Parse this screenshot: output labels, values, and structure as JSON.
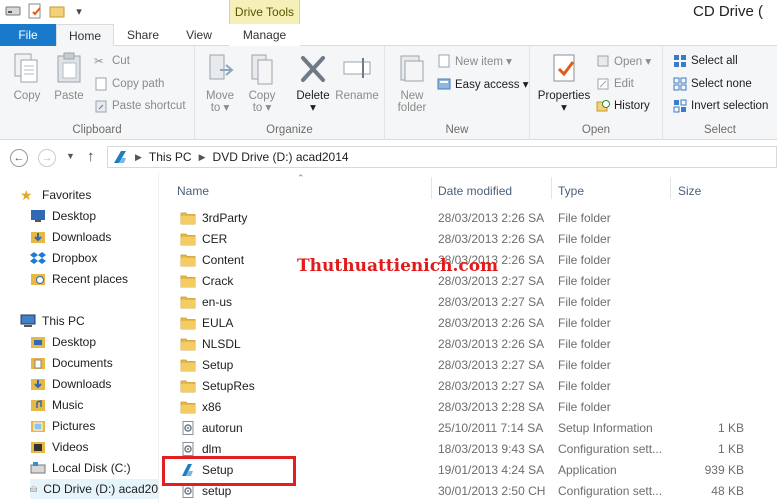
{
  "window": {
    "title": "CD Drive ("
  },
  "context_tab": {
    "label": "Drive Tools"
  },
  "tabs": {
    "file": "File",
    "home": "Home",
    "share": "Share",
    "view": "View",
    "manage": "Manage"
  },
  "ribbon": {
    "clipboard": {
      "label": "Clipboard",
      "copy": "Copy",
      "paste": "Paste",
      "cut": "Cut",
      "copy_path": "Copy path",
      "paste_shortcut": "Paste shortcut"
    },
    "organize": {
      "label": "Organize",
      "move_to": [
        "Move",
        "to ▾"
      ],
      "copy_to": [
        "Copy",
        "to ▾"
      ],
      "delete": [
        "Delete",
        "▾"
      ],
      "rename": "Rename"
    },
    "new": {
      "label": "New",
      "new_folder": [
        "New",
        "folder"
      ],
      "new_item": "New item ▾",
      "easy_access": "Easy access ▾"
    },
    "open": {
      "label": "Open",
      "properties": [
        "Properties",
        "▾"
      ],
      "open": "Open ▾",
      "edit": "Edit",
      "history": "History"
    },
    "select": {
      "label": "Select",
      "select_all": "Select all",
      "select_none": "Select none",
      "invert": "Invert selection"
    }
  },
  "address": {
    "crumbs": [
      "This PC",
      "DVD Drive (D:) acad2014"
    ]
  },
  "nav": {
    "favorites": "Favorites",
    "desktop": "Desktop",
    "downloads": "Downloads",
    "dropbox": "Dropbox",
    "recent": "Recent places",
    "this_pc": "This PC",
    "pc_desktop": "Desktop",
    "documents": "Documents",
    "pc_downloads": "Downloads",
    "music": "Music",
    "pictures": "Pictures",
    "videos": "Videos",
    "local_disk": "Local Disk (C:)",
    "cd_drive": "CD Drive (D:) acad20"
  },
  "columns": {
    "name": "Name",
    "date": "Date modified",
    "type": "Type",
    "size": "Size"
  },
  "files": [
    {
      "name": "3rdParty",
      "date": "28/03/2013 2:26 SA",
      "type": "File folder",
      "size": "",
      "icon": "folder-icon"
    },
    {
      "name": "CER",
      "date": "28/03/2013 2:26 SA",
      "type": "File folder",
      "size": "",
      "icon": "folder-icon"
    },
    {
      "name": "Content",
      "date": "28/03/2013 2:26 SA",
      "type": "File folder",
      "size": "",
      "icon": "folder-icon"
    },
    {
      "name": "Crack",
      "date": "28/03/2013 2:27 SA",
      "type": "File folder",
      "size": "",
      "icon": "folder-icon"
    },
    {
      "name": "en-us",
      "date": "28/03/2013 2:27 SA",
      "type": "File folder",
      "size": "",
      "icon": "folder-icon"
    },
    {
      "name": "EULA",
      "date": "28/03/2013 2:26 SA",
      "type": "File folder",
      "size": "",
      "icon": "folder-icon"
    },
    {
      "name": "NLSDL",
      "date": "28/03/2013 2:26 SA",
      "type": "File folder",
      "size": "",
      "icon": "folder-icon"
    },
    {
      "name": "Setup",
      "date": "28/03/2013 2:27 SA",
      "type": "File folder",
      "size": "",
      "icon": "folder-icon"
    },
    {
      "name": "SetupRes",
      "date": "28/03/2013 2:27 SA",
      "type": "File folder",
      "size": "",
      "icon": "folder-icon"
    },
    {
      "name": "x86",
      "date": "28/03/2013 2:28 SA",
      "type": "File folder",
      "size": "",
      "icon": "folder-icon"
    },
    {
      "name": "autorun",
      "date": "25/10/2011 7:14 SA",
      "type": "Setup Information",
      "size": "1 KB",
      "icon": "settings-file-icon"
    },
    {
      "name": "dlm",
      "date": "18/03/2013 9:43 SA",
      "type": "Configuration sett...",
      "size": "1 KB",
      "icon": "settings-file-icon"
    },
    {
      "name": "Setup",
      "date": "19/01/2013 4:24 SA",
      "type": "Application",
      "size": "939 KB",
      "icon": "autodesk-app-icon"
    },
    {
      "name": "setup",
      "date": "30/01/2013 2:50 CH",
      "type": "Configuration sett...",
      "size": "48 KB",
      "icon": "settings-file-icon"
    }
  ],
  "watermark": "Thuthuattienich.com",
  "colors": {
    "accent": "#1979ca",
    "highlight": "#e02020",
    "folder": "#e8b844",
    "drive_tools": "#f4f0b8"
  }
}
